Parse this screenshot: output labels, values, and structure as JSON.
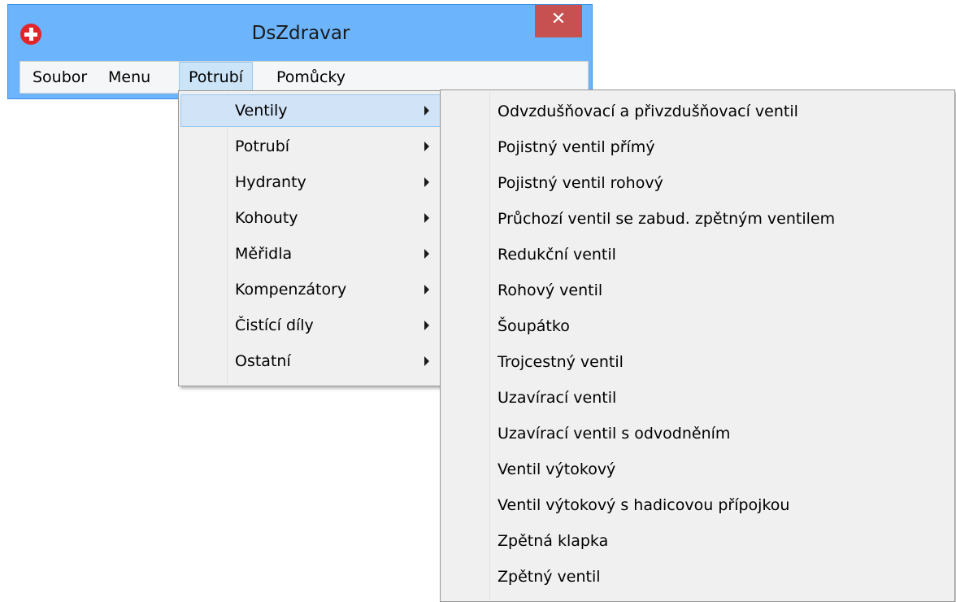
{
  "window": {
    "title": "DsZdravar",
    "close_glyph": "✕",
    "icon": "red-cross-icon"
  },
  "menubar": [
    {
      "label": "Soubor"
    },
    {
      "label": "Menu"
    },
    {
      "label": "Potrubí",
      "active": true
    },
    {
      "label": "Pomůcky"
    }
  ],
  "potrubi_menu": [
    {
      "label": "Ventily",
      "highlighted": true
    },
    {
      "label": "Potrubí"
    },
    {
      "label": "Hydranty"
    },
    {
      "label": "Kohouty"
    },
    {
      "label": "Měřidla"
    },
    {
      "label": "Kompenzátory"
    },
    {
      "label": "Čistící díly"
    },
    {
      "label": "Ostatní"
    }
  ],
  "ventily_menu": [
    "Odvzdušňovací a přivzdušňovací ventil",
    "Pojistný ventil přímý",
    "Pojistný ventil rohový",
    "Průchozí ventil se zabud. zpětným ventilem",
    "Redukční ventil",
    "Rohový ventil",
    "Šoupátko",
    "Trojcestný ventil",
    "Uzavírací ventil",
    "Uzavírací ventil s odvodněním",
    "Ventil výtokový",
    "Ventil výtokový s hadicovou přípojkou",
    "Zpětná klapka",
    "Zpětný ventil"
  ]
}
